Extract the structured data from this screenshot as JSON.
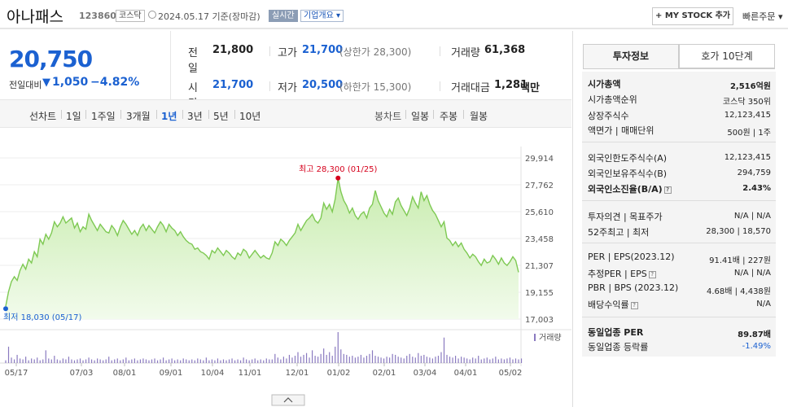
{
  "header": {
    "name": "아나패스",
    "code": "123860",
    "market": "코스닥",
    "date": "2024.05.17 기준(장마감)",
    "live": "실시간",
    "company_info": "기업개요 ▾",
    "mystock": "+ MY STOCK 추가",
    "quick_order": "빠른주문 ▾"
  },
  "price": {
    "current": "20,750",
    "change_label": "전일대비",
    "change_arrow": "▼",
    "change_amount": "1,050",
    "change_pct": "−4.82%"
  },
  "quote": {
    "prev_label": "전일",
    "prev": "21,800",
    "high_label": "고가",
    "high": "21,700",
    "upper_limit": "(상한가 28,300)",
    "volume_label": "거래량",
    "volume": "61,368",
    "open_label": "시가",
    "open": "21,700",
    "low_label": "저가",
    "low": "20,500",
    "lower_limit": "(하한가 15,300)",
    "amount_label": "거래대금",
    "amount": "1,281",
    "amount_unit": "백만"
  },
  "range_bar": {
    "line_label": "선차트",
    "ranges": [
      "1일",
      "1주일",
      "3개월",
      "1년",
      "3년",
      "5년",
      "10년"
    ],
    "active_range": "1년",
    "candle_label": "봉차트",
    "candles": [
      "일봉",
      "주봉",
      "월봉"
    ]
  },
  "right_panel": {
    "tab_invest": "투자정보",
    "tab_quote": "호가 10단계",
    "rows": {
      "mcap_label": "시가총액",
      "mcap": "2,516억원",
      "mcap_rank_label": "시가총액순위",
      "mcap_rank": "코스닥 350위",
      "shares_label": "상장주식수",
      "shares": "12,123,415",
      "par_label": "액면가 | 매매단위",
      "par": "500원 | 1주",
      "foreign_limit_label": "외국인한도주식수(A)",
      "foreign_limit": "12,123,415",
      "foreign_hold_label": "외국인보유주식수(B)",
      "foreign_hold": "294,759",
      "foreign_ratio_label": "외국인소진율(B/A)",
      "foreign_ratio": "2.43%",
      "opinion_label": "투자의견 | 목표주가",
      "opinion": "N/A | N/A",
      "w52_label": "52주최고 | 최저",
      "w52": "28,300 | 18,570",
      "per_label": "PER | EPS(2023.12)",
      "per": "91.41배 | 227원",
      "est_per_label": "추정PER | EPS",
      "est_per": "N/A | N/A",
      "pbr_label": "PBR | BPS (2023.12)",
      "pbr": "4.68배 | 4,438원",
      "div_label": "배당수익률",
      "div": "N/A",
      "ind_per_label": "동일업종 PER",
      "ind_per": "89.87배",
      "ind_chg_label": "동일업종 등락률",
      "ind_chg": "-1.49%"
    }
  },
  "chart_data": {
    "type": "area",
    "y_ticks": [
      "29,914",
      "27,762",
      "25,610",
      "23,458",
      "21,307",
      "19,155",
      "17,003"
    ],
    "ylim": [
      17003,
      29914
    ],
    "x_ticks": [
      "05/17",
      "07/03",
      "08/01",
      "09/01",
      "10/04",
      "11/01",
      "12/01",
      "01/02",
      "02/01",
      "03/04",
      "04/01",
      "05/02"
    ],
    "high_label": "최고 28,300 (01/25)",
    "low_label": "최저 18,030 (05/17)",
    "volume_label": "거래량",
    "colors": {
      "line": "#7ec953",
      "fill_top": "#c8ecae",
      "fill_bottom": "#f2fbec",
      "high": "#d6001c",
      "low": "#1b61d1"
    },
    "prices": [
      18030,
      19200,
      20000,
      20400,
      20100,
      20900,
      21400,
      21000,
      21800,
      21500,
      22400,
      22000,
      23400,
      23000,
      23800,
      23400,
      23900,
      24800,
      24400,
      24700,
      25200,
      24700,
      24900,
      25100,
      24300,
      24700,
      24000,
      24400,
      24200,
      25400,
      24900,
      24500,
      24100,
      24600,
      24300,
      24000,
      23900,
      24500,
      24200,
      23700,
      24400,
      24900,
      24600,
      24200,
      23800,
      24100,
      23700,
      24300,
      24600,
      24100,
      24500,
      24200,
      23900,
      24400,
      24800,
      24500,
      24000,
      24600,
      24300,
      24100,
      23700,
      24000,
      23600,
      23300,
      23100,
      23000,
      22600,
      22700,
      22400,
      22300,
      22100,
      21800,
      22500,
      22300,
      22700,
      22400,
      22100,
      22500,
      22300,
      22000,
      21800,
      22300,
      22100,
      22600,
      22400,
      21900,
      22200,
      22500,
      22200,
      21900,
      22100,
      21900,
      21800,
      22300,
      23200,
      22900,
      23400,
      23200,
      22900,
      23300,
      23600,
      23900,
      24600,
      24100,
      24500,
      24900,
      25100,
      25400,
      24900,
      24700,
      25100,
      26300,
      25800,
      26200,
      25600,
      26600,
      28300,
      27200,
      26500,
      26100,
      25500,
      25900,
      25300,
      25000,
      25400,
      25600,
      25100,
      25900,
      26200,
      27300,
      26500,
      26000,
      25500,
      25200,
      25800,
      25400,
      26400,
      26700,
      26100,
      25700,
      25300,
      25900,
      26800,
      26300,
      25900,
      27200,
      26500,
      26900,
      26200,
      25700,
      25400,
      24900,
      24400,
      24800,
      23500,
      23300,
      22900,
      23200,
      22800,
      23100,
      22600,
      22300,
      21900,
      22200,
      22000,
      21600,
      21300,
      21800,
      21500,
      21600,
      22100,
      21800,
      21400,
      21900,
      21500,
      21300,
      21600,
      22000,
      21700,
      20750
    ],
    "volumes": [
      3,
      18,
      6,
      4,
      9,
      5,
      4,
      7,
      3,
      5,
      4,
      6,
      3,
      4,
      14,
      5,
      4,
      8,
      4,
      3,
      5,
      4,
      7,
      4,
      3,
      4,
      5,
      3,
      4,
      6,
      4,
      3,
      5,
      4,
      3,
      4,
      7,
      3,
      4,
      5,
      3,
      4,
      6,
      3,
      4,
      5,
      3,
      4,
      5,
      4,
      3,
      4,
      5,
      3,
      4,
      6,
      3,
      4,
      5,
      3,
      4,
      3,
      5,
      4,
      3,
      4,
      3,
      5,
      4,
      3,
      6,
      3,
      4,
      3,
      5,
      3,
      4,
      3,
      4,
      5,
      3,
      4,
      3,
      6,
      4,
      3,
      4,
      5,
      3,
      4,
      3,
      5,
      4,
      4,
      10,
      6,
      4,
      7,
      5,
      9,
      6,
      8,
      12,
      7,
      9,
      11,
      6,
      14,
      8,
      7,
      10,
      16,
      9,
      12,
      8,
      18,
      34,
      15,
      10,
      9,
      7,
      8,
      6,
      7,
      9,
      6,
      8,
      10,
      14,
      8,
      7,
      6,
      5,
      7,
      6,
      10,
      9,
      7,
      6,
      5,
      8,
      10,
      7,
      6,
      11,
      8,
      9,
      7,
      6,
      5,
      7,
      8,
      12,
      28,
      9,
      7,
      6,
      8,
      5,
      7,
      6,
      5,
      4,
      6,
      5,
      8,
      4,
      5,
      6,
      4,
      5,
      7,
      4,
      5,
      4,
      5,
      6,
      4,
      5,
      4,
      5
    ]
  }
}
